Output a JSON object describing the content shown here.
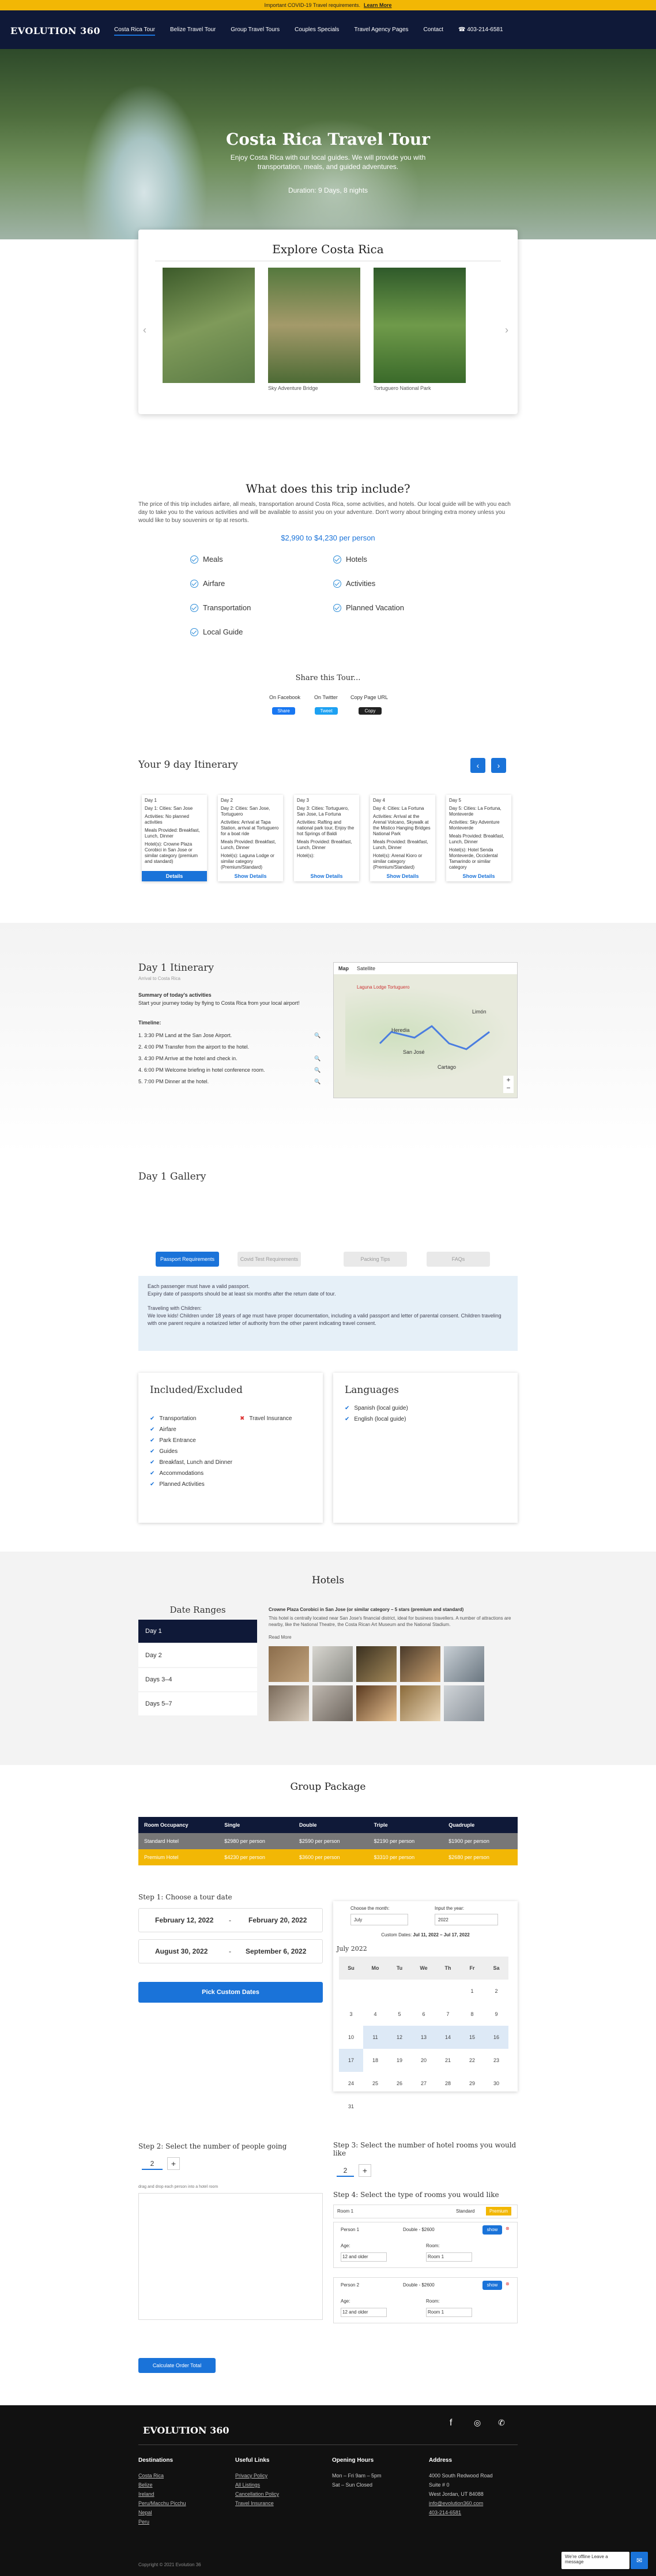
{
  "notice": {
    "text": "Important COVID-19 Travel requirements.",
    "link": "Learn More"
  },
  "nav": {
    "logo": "EVOLUTION 360",
    "items": [
      "Costa Rica Tour",
      "Belize Travel Tour",
      "Group Travel Tours",
      "Couples Specials",
      "Travel Agency Pages",
      "Contact"
    ],
    "phone": "☎ 403-214-6581"
  },
  "hero": {
    "title": "Costa Rica Travel Tour",
    "subtitle": "Enjoy Costa Rica with our local guides. We will provide you with transportation, meals, and guided adventures.",
    "duration": "Duration: 9 Days, 8 nights"
  },
  "explore": {
    "title": "Explore Costa Rica",
    "captions": [
      "",
      "Sky Adventure Bridge",
      "Tortuguero National Park"
    ]
  },
  "include": {
    "title": "What does this trip include?",
    "body": "The price of this trip includes airfare, all meals, transportation around Costa Rica, some activities, and hotels. Our local guide will be with you each day to take you to the various activities and will be available to assist you on your adventure. Don't worry about bringing extra money unless you would like to buy souvenirs or tip at resorts.",
    "price": "$2,990 to $4,230 per person",
    "items_left": [
      "Meals",
      "Airfare",
      "Transportation",
      "Local Guide"
    ],
    "items_right": [
      "Hotels",
      "Activities",
      "Planned Vacation"
    ]
  },
  "share": {
    "title": "Share this Tour...",
    "labels": [
      "On Facebook",
      "On Twitter",
      "Copy Page URL"
    ],
    "buttons": [
      "Share",
      "Tweet",
      "Copy"
    ]
  },
  "itinerary": {
    "title": "Your 9 day Itinerary",
    "cards": [
      {
        "day": "Day 1",
        "meta": "Day 1: Cities: San Jose",
        "acts": "Activities: No planned activities",
        "meals": "Meals Provided: Breakfast, Lunch, Dinner",
        "hotel": "Hotel(s): Crowne Plaza Corobici in San Jose or similar category (premium and standard)",
        "btn": "Details"
      },
      {
        "day": "Day 2",
        "meta": "Day 2: Cities: San Jose, Tortuguero",
        "acts": "Activities: Arrival at Tapa Station, arrival at Tortuguero for a boat ride",
        "meals": "Meals Provided: Breakfast, Lunch, Dinner",
        "hotel": "Hotel(s): Laguna Lodge or similar category (Premium/Standard)",
        "btn": "Show Details"
      },
      {
        "day": "Day 3",
        "meta": "Day 3: Cities: Tortuguero, San Jose, La Fortuna",
        "acts": "Activities: Rafting and national park tour, Enjoy the hot Springs of Baldi",
        "meals": "Meals Provided: Breakfast, Lunch, Dinner",
        "hotel": "Hotel(s):",
        "btn": "Show Details"
      },
      {
        "day": "Day 4",
        "meta": "Day 4: Cities: La Fortuna",
        "acts": "Activities: Arrival at the Arenal Volcano, Skywalk at the Mistico Hanging Bridges National Park",
        "meals": "Meals Provided: Breakfast, Lunch, Dinner",
        "hotel": "Hotel(s): Arenal Kioro or similar category (Premium/Standard)",
        "btn": "Show Details"
      },
      {
        "day": "Day 5",
        "meta": "Day 5: Cities: La Fortuna, Monteverde",
        "acts": "Activities: Sky Adventure Monteverde",
        "meals": "Meals Provided: Breakfast, Lunch, Dinner",
        "hotel": "Hotel(s): Hotel Senda Monteverde, Occidental Tamarindo or similar category",
        "btn": "Show Details"
      }
    ]
  },
  "day1": {
    "title": "Day 1 Itinerary",
    "sub": "Arrival to Costa Rica",
    "summary_title": "Summary of today's activities",
    "summary": "Start your journey today by flying to Costa Rica from your local airport!",
    "timeline_title": "Timeline:",
    "timeline": [
      "1. 3:30 PM Land at the San Jose Airport.",
      "2. 4:00 PM Transfer from the airport to the hotel.",
      "3. 4:30 PM Arrive at the hotel and check in.",
      "4. 6:00 PM Welcome briefing in hotel conference room.",
      "5. 7:00 PM Dinner at the hotel."
    ],
    "map_tabs": [
      "Map",
      "Satellite"
    ],
    "map_labels": [
      "Laguna Lodge Tortuguero",
      "San José",
      "Limón",
      "Cartago",
      "Heredia"
    ]
  },
  "gallery": {
    "title": "Day 1 Gallery"
  },
  "reqs": {
    "tabs": [
      "Passport Requirements",
      "Covid Test Requirements",
      "Packing Tips",
      "FAQs"
    ],
    "p1": "Each passenger must have a valid passport.",
    "p2": "Expiry date of passports should be at least six months after the return date of tour.",
    "p3": "Traveling with Children:",
    "p4": "We love kids! Children under 18 years of age must have proper documentation, including a valid passport and letter of parental consent. Children traveling with one parent require a notarized letter of authority from the other parent indicating travel consent."
  },
  "included": {
    "title": "Included/Excluded",
    "yes": [
      "Transportation",
      "Airfare",
      "Park Entrance",
      "Guides",
      "Breakfast, Lunch and Dinner",
      "Accommodations",
      "Planned Activities"
    ],
    "no": [
      "Travel Insurance"
    ]
  },
  "languages": {
    "title": "Languages",
    "items": [
      "Spanish (local guide)",
      "English (local guide)"
    ]
  },
  "hotels": {
    "title": "Hotels",
    "ranges_title": "Date Ranges",
    "ranges": [
      "Day 1",
      "Day 2",
      "Days 3–4",
      "Days 5–7"
    ],
    "hotel_name": "Crowne Plaza Corobici in San Jose (or similar category – 5 stars (premium and standard)",
    "hotel_desc": "This hotel is centrally located near San Jose's financial district, ideal for business travellers. A number of attractions are nearby, like the National Theatre, the Costa Rican Art Museum and the National Stadium.",
    "read_more": "Read More"
  },
  "group": {
    "title": "Group Package",
    "headers": [
      "Room Occupancy",
      "Single",
      "Double",
      "Triple",
      "Quadruple"
    ],
    "rows": [
      [
        "Standard Hotel",
        "$2980 per person",
        "$2590 per person",
        "$2190 per person",
        "$1900 per person"
      ],
      [
        "Premium Hotel",
        "$4230 per person",
        "$3600 per person",
        "$3310 per person",
        "$2680 per person"
      ]
    ]
  },
  "dates": {
    "step1": "Step 1: Choose a tour date",
    "ranges": [
      [
        "February 12, 2022",
        "February 20, 2022"
      ],
      [
        "August 30, 2022",
        "September 6, 2022"
      ]
    ],
    "pick": "Pick Custom Dates",
    "choose_month": "Choose the month:",
    "input_year": "Input the year:",
    "month": "July",
    "year": "2022",
    "custom": "Custom Dates:",
    "custom_val": "Jul 11, 2022 – Jul 17, 2022",
    "cal_title": "July 2022",
    "dow": [
      "Su",
      "Mo",
      "Tu",
      "We",
      "Th",
      "Fr",
      "Sa"
    ],
    "weeks": [
      [
        "",
        "",
        "",
        "",
        "",
        "1",
        "2"
      ],
      [
        "3",
        "4",
        "5",
        "6",
        "7",
        "8",
        "9"
      ],
      [
        "10",
        "11",
        "12",
        "13",
        "14",
        "15",
        "16"
      ],
      [
        "17",
        "18",
        "19",
        "20",
        "21",
        "22",
        "23"
      ],
      [
        "24",
        "25",
        "26",
        "27",
        "28",
        "29",
        "30"
      ],
      [
        "31",
        "",
        "",
        "",
        "",
        "",
        ""
      ]
    ]
  },
  "people": {
    "step2": "Step 2: Select the number of people going",
    "count": "2",
    "drag": "drag and drop each person into a hotel room"
  },
  "rooms": {
    "step3": "Step 3: Select the number of hotel rooms you would like",
    "count": "2",
    "step4": "Step 4: Select the type of rooms you would like",
    "room_label": "Room 1",
    "standard": "Standard",
    "premium": "Premium",
    "person1": "Person 1",
    "double": "Double - $2600",
    "show": "show",
    "age": "Age:",
    "room": "Room:",
    "age_val": "12 and older",
    "room_val": "Room 1",
    "person2": "Person 2",
    "double2": "Double - $2600"
  },
  "calc": "Calculate Order Total",
  "footer": {
    "logo": "EVOLUTION 360",
    "cols": [
      {
        "title": "Destinations",
        "items": [
          "Costa Rica",
          "Belize",
          "Ireland",
          "Peru/Macchu Picchu",
          "Nepal",
          "Peru"
        ]
      },
      {
        "title": "Useful Links",
        "items": [
          "Privacy Policy",
          "All Listings",
          "Cancellation Policy",
          "Travel Insurance"
        ]
      },
      {
        "title": "Opening Hours",
        "items": [
          "Mon – Fri 9am – 5pm",
          "Sat – Sun Closed"
        ]
      },
      {
        "title": "Address",
        "items": [
          "4000 South Redwood Road",
          "Suite # 0",
          "West Jordan, UT 84088",
          "info@evolution360.com",
          "403-214-6581"
        ]
      }
    ],
    "copy": "Copyright © 2021 Evolution 36",
    "chat": "We're offline Leave a message"
  }
}
